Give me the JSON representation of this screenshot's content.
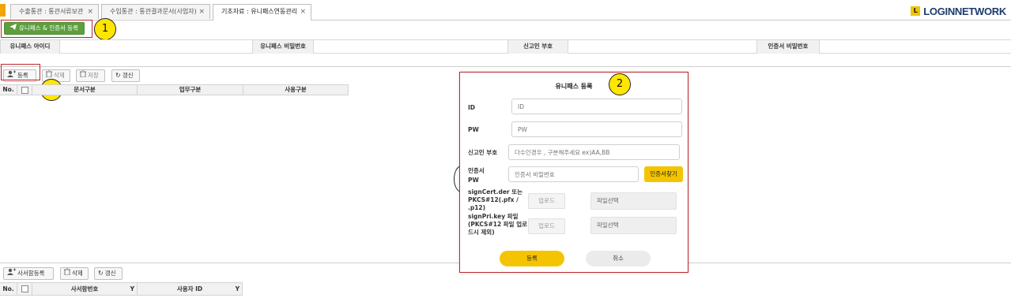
{
  "tabs": [
    {
      "label": "수출통관 : 통관서류보관",
      "close": "×"
    },
    {
      "label": "수입통관 : 통관결과문서(사업자)",
      "close": "×"
    },
    {
      "label": "기초자료 : 유니패스연동관리",
      "close": "×"
    }
  ],
  "logo": {
    "mark": "L",
    "word": "LOGINNETWORK"
  },
  "top_action": {
    "label": "유니패스 & 인증서 등록"
  },
  "info_row": {
    "unipass_id": "유니패스 아이디",
    "unipass_pw": "유니패스 비밀번호",
    "declarant_code": "신고인 부호",
    "cert_pw": "인증서 비밀번호"
  },
  "toolbar": {
    "register": "등록",
    "delete": "삭제",
    "save": "저장",
    "refresh": "갱신"
  },
  "grid": {
    "no": "No.",
    "col1": "문서구분",
    "col2": "업무구분",
    "col3": "사용구분"
  },
  "bottom_toolbar": {
    "register": "사서함등록",
    "delete": "삭제",
    "refresh": "갱신"
  },
  "grid2": {
    "no": "No.",
    "col1": "사서함번호",
    "col2": "사용자 ID",
    "filter": "Y"
  },
  "callouts": {
    "one": "1",
    "two": "2",
    "three": "3"
  },
  "modal": {
    "title": "유니패스 등록",
    "id_label": "ID",
    "id_placeholder": "ID",
    "pw_label": "PW",
    "pw_placeholder": "PW",
    "code_label": "신고인 부호",
    "code_placeholder": "다수인경우 , 구분해주세요 ex)AA,BB",
    "cert_label_1": "인증서",
    "cert_label_2": "PW",
    "cert_placeholder": "인증서 비밀번호",
    "find_cert": "인증서찾기",
    "signcert_label": "signCert.der 또는 PKCS#12(.pfx / .p12)",
    "signpri_label": "signPri.key 파일 (PKCS#12 파일 업로드시 제외)",
    "upload": "업로드",
    "file_select": "파일선택",
    "submit": "등록",
    "cancel": "취소"
  },
  "colors": {
    "accent_green": "#5e9e3e",
    "accent_yellow": "#f4c400",
    "highlight_red": "#c0242b"
  }
}
